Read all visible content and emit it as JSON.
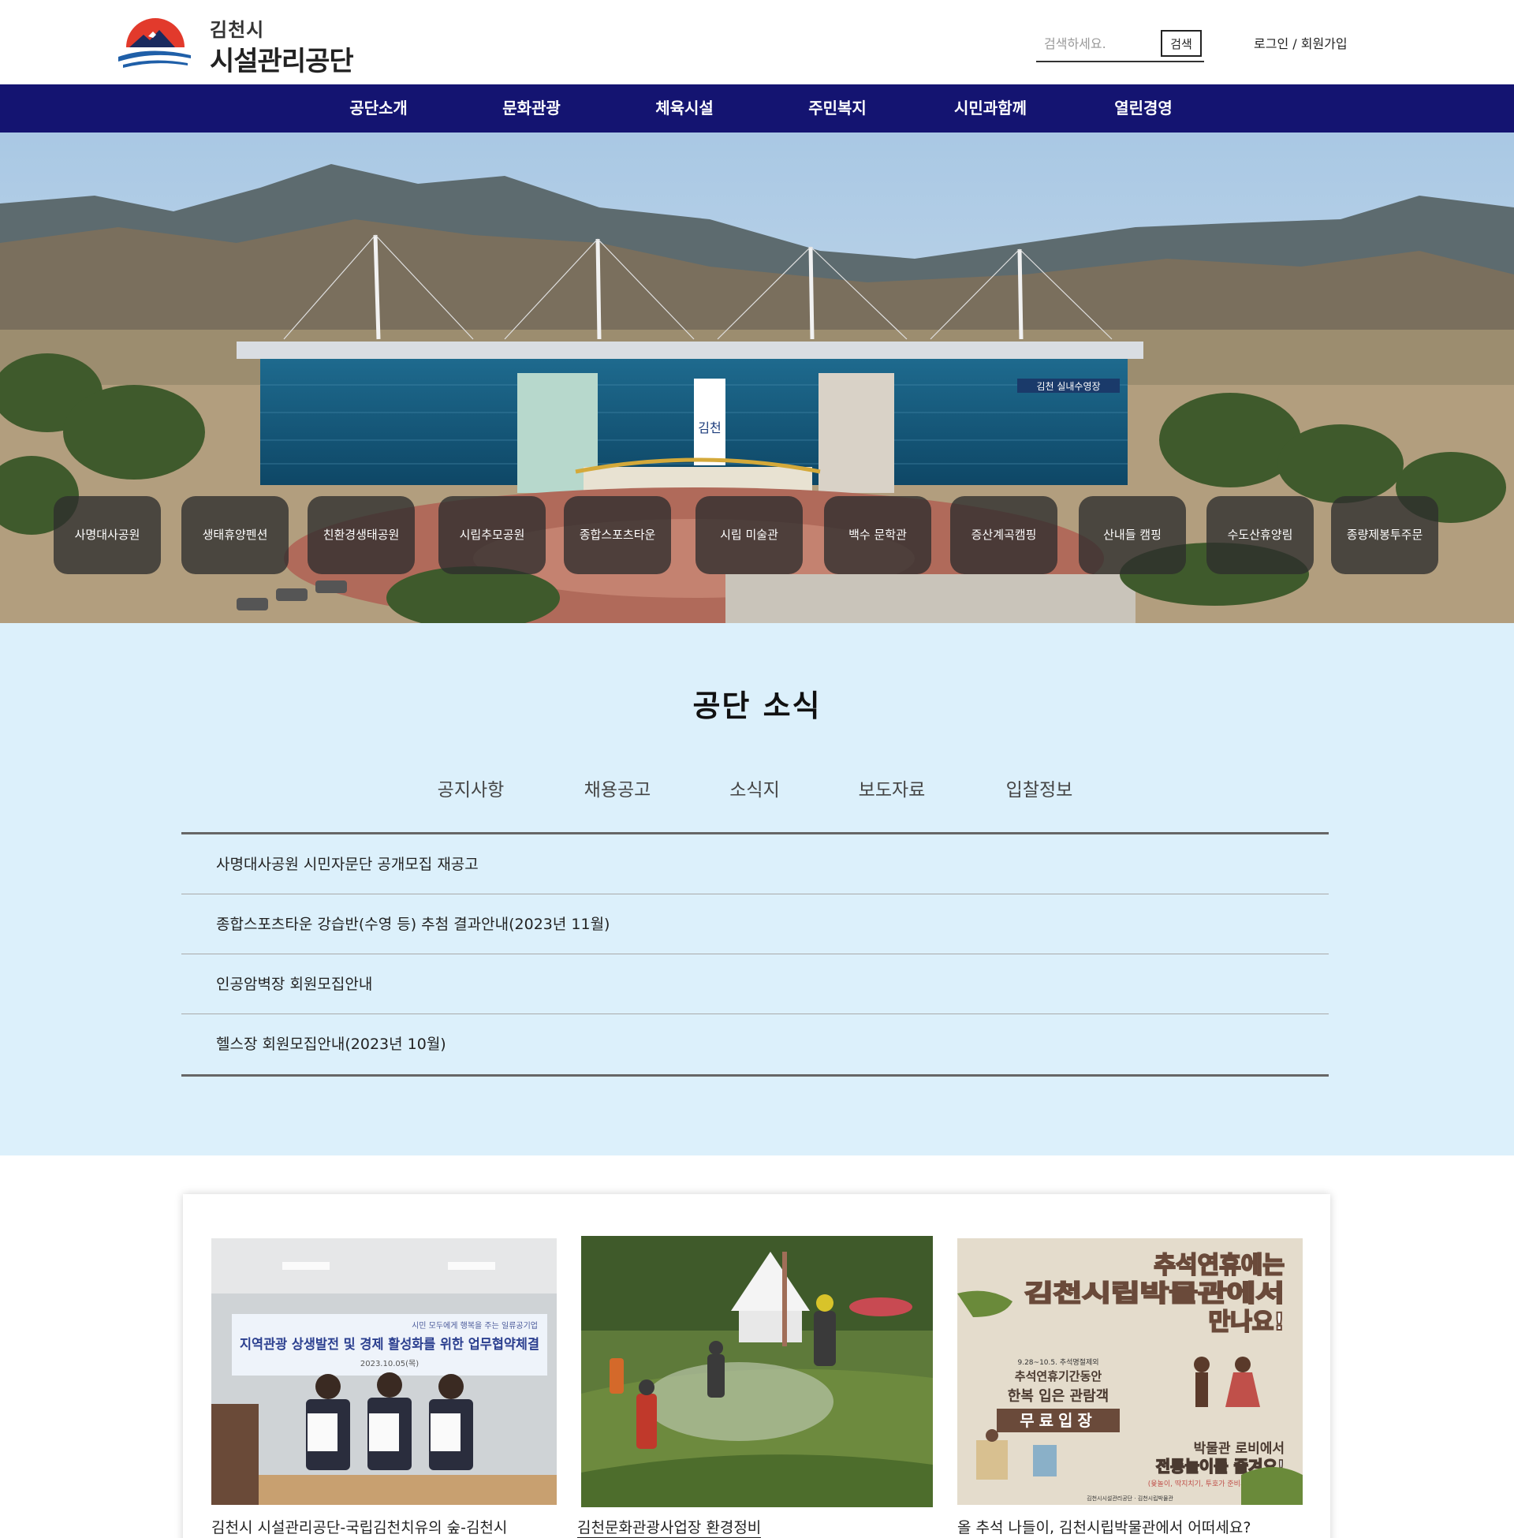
{
  "header": {
    "logo_small": "김천시",
    "logo_big": "시설관리공단",
    "search_placeholder": "검색하세요.",
    "search_button": "검색",
    "login": "로그인",
    "separator": " / ",
    "signup": "회원가입"
  },
  "nav": [
    "공단소개",
    "문화관광",
    "체육시설",
    "주민복지",
    "시민과함께",
    "열린경영"
  ],
  "hero": {
    "building_sign": "김천 실내수영장",
    "banner_text": "김천",
    "facilities": [
      "사명대사공원",
      "생태휴양펜션",
      "친환경생태공원",
      "시립추모공원",
      "종합스포츠타운",
      "시립 미술관",
      "백수 문학관",
      "증산계곡캠핑",
      "산내들 캠핑",
      "수도산휴양림",
      "종량제봉투주문"
    ]
  },
  "news": {
    "title": "공단 소식",
    "tabs": [
      "공지사항",
      "채용공고",
      "소식지",
      "보도자료",
      "입찰정보"
    ],
    "items": [
      "사명대사공원 시민자문단 공개모집 재공고",
      "종합스포츠타운 강습반(수영 등) 추첨 결과안내(2023년 11월)",
      "인공암벽장 회원모집안내",
      "헬스장 회원모집안내(2023년 10월)"
    ]
  },
  "gallery": {
    "cards": [
      {
        "title": "김천시 시설관리공단-국립김천치유의 숲-김천시",
        "banner_small": "시민 모두에게 행복을 주는 일류공기업",
        "banner_big": "지역관광 상생발전 및 경제 활성화를 위한 업무협약체결",
        "banner_date": "2023.10.05(목)"
      },
      {
        "title": "김천문화관광사업장 환경정비"
      },
      {
        "title": "올 추석 나들이, 김천시립박물관에서 어떠세요?",
        "poster_line1": "추석연휴에는",
        "poster_line2": "김천시립박물관에서",
        "poster_line3": "만나요!",
        "poster_date": "9.28~10.5. 추석명절제외",
        "poster_sub1": "추석연휴기간동안",
        "poster_sub2": "한복 입은 관람객",
        "poster_free": "무료입장",
        "poster_sub3": "박물관 로비에서",
        "poster_sub4": "전통놀이를 즐겨요!",
        "poster_note": "(윷놀이, 딱지치기, 투호가 준비되어 있습니다)",
        "poster_footer": "김천시시설관리공단 · 김천시립박물관"
      }
    ]
  },
  "colors": {
    "nav_bg": "#141471",
    "news_bg": "#dcf0fb",
    "logo_red": "#e23a2c",
    "logo_blue": "#1f5fa8"
  }
}
